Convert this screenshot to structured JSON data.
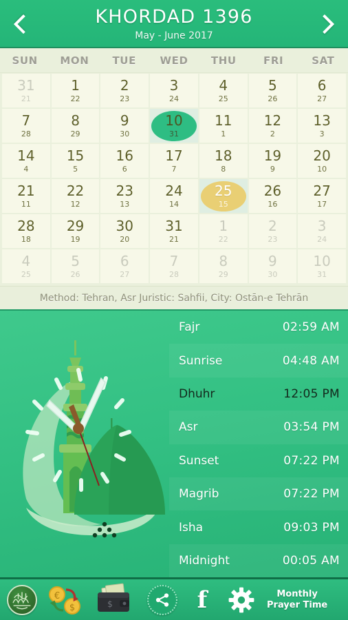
{
  "header": {
    "month_title": "KHORDAD 1396",
    "gregorian_range": "May - June 2017",
    "prev_icon": "chevron-left-icon",
    "next_icon": "chevron-right-icon",
    "bg_color": "#2abd7c"
  },
  "weekdays": [
    "SUN",
    "MON",
    "TUE",
    "WED",
    "THU",
    "FRI",
    "SAT"
  ],
  "calendar": {
    "rows": [
      [
        {
          "main": "31",
          "sub": "21",
          "state": "muted"
        },
        {
          "main": "1",
          "sub": "22",
          "state": "normal"
        },
        {
          "main": "2",
          "sub": "23",
          "state": "normal"
        },
        {
          "main": "3",
          "sub": "24",
          "state": "normal"
        },
        {
          "main": "4",
          "sub": "25",
          "state": "normal"
        },
        {
          "main": "5",
          "sub": "26",
          "state": "normal"
        },
        {
          "main": "6",
          "sub": "27",
          "state": "normal"
        }
      ],
      [
        {
          "main": "7",
          "sub": "28",
          "state": "normal"
        },
        {
          "main": "8",
          "sub": "29",
          "state": "normal"
        },
        {
          "main": "9",
          "sub": "30",
          "state": "normal"
        },
        {
          "main": "10",
          "sub": "31",
          "state": "selected-green"
        },
        {
          "main": "11",
          "sub": "1",
          "state": "normal"
        },
        {
          "main": "12",
          "sub": "2",
          "state": "normal"
        },
        {
          "main": "13",
          "sub": "3",
          "state": "normal"
        }
      ],
      [
        {
          "main": "14",
          "sub": "4",
          "state": "normal"
        },
        {
          "main": "15",
          "sub": "5",
          "state": "normal"
        },
        {
          "main": "16",
          "sub": "6",
          "state": "normal"
        },
        {
          "main": "17",
          "sub": "7",
          "state": "normal"
        },
        {
          "main": "18",
          "sub": "8",
          "state": "normal"
        },
        {
          "main": "19",
          "sub": "9",
          "state": "normal"
        },
        {
          "main": "20",
          "sub": "10",
          "state": "normal"
        }
      ],
      [
        {
          "main": "21",
          "sub": "11",
          "state": "normal"
        },
        {
          "main": "22",
          "sub": "12",
          "state": "normal"
        },
        {
          "main": "23",
          "sub": "13",
          "state": "normal"
        },
        {
          "main": "24",
          "sub": "14",
          "state": "normal"
        },
        {
          "main": "25",
          "sub": "15",
          "state": "selected-yellow"
        },
        {
          "main": "26",
          "sub": "16",
          "state": "normal"
        },
        {
          "main": "27",
          "sub": "17",
          "state": "normal"
        }
      ],
      [
        {
          "main": "28",
          "sub": "18",
          "state": "normal"
        },
        {
          "main": "29",
          "sub": "19",
          "state": "normal"
        },
        {
          "main": "30",
          "sub": "20",
          "state": "normal"
        },
        {
          "main": "31",
          "sub": "21",
          "state": "normal"
        },
        {
          "main": "1",
          "sub": "22",
          "state": "muted"
        },
        {
          "main": "2",
          "sub": "23",
          "state": "muted"
        },
        {
          "main": "3",
          "sub": "24",
          "state": "muted"
        }
      ],
      [
        {
          "main": "4",
          "sub": "25",
          "state": "muted"
        },
        {
          "main": "5",
          "sub": "26",
          "state": "muted"
        },
        {
          "main": "6",
          "sub": "27",
          "state": "muted"
        },
        {
          "main": "7",
          "sub": "28",
          "state": "muted"
        },
        {
          "main": "8",
          "sub": "29",
          "state": "muted"
        },
        {
          "main": "9",
          "sub": "30",
          "state": "muted"
        },
        {
          "main": "10",
          "sub": "31",
          "state": "muted"
        }
      ]
    ],
    "selected_green_color": "#2ebd83",
    "selected_yellow_color": "#e9cf74"
  },
  "method_bar": {
    "text": "Method: Tehran, Asr Juristic: Sahfii, City: Ostān-e Tehrān"
  },
  "prayers": [
    {
      "name": "Fajr",
      "time": "02:59 AM",
      "current": false
    },
    {
      "name": "Sunrise",
      "time": "04:48 AM",
      "current": false
    },
    {
      "name": "Dhuhr",
      "time": "12:05 PM",
      "current": true
    },
    {
      "name": "Asr",
      "time": "03:54 PM",
      "current": false
    },
    {
      "name": "Sunset",
      "time": "07:22 PM",
      "current": false
    },
    {
      "name": "Magrib",
      "time": "07:22 PM",
      "current": false
    },
    {
      "name": "Isha",
      "time": "09:03 PM",
      "current": false
    },
    {
      "name": "Midnight",
      "time": "00:05 AM",
      "current": false
    }
  ],
  "illustration": {
    "name": "mosque-clock-illustration"
  },
  "toolbar": {
    "quran_icon": "quran-calligraphy-icon",
    "exchange_icon": "currency-exchange-icon",
    "wallet_icon": "wallet-icon",
    "share_icon": "share-icon",
    "facebook_icon": "facebook-icon",
    "facebook_glyph": "f",
    "settings_icon": "gear-icon",
    "monthly_line1": "Monthly",
    "monthly_line2": "Prayer Time"
  }
}
